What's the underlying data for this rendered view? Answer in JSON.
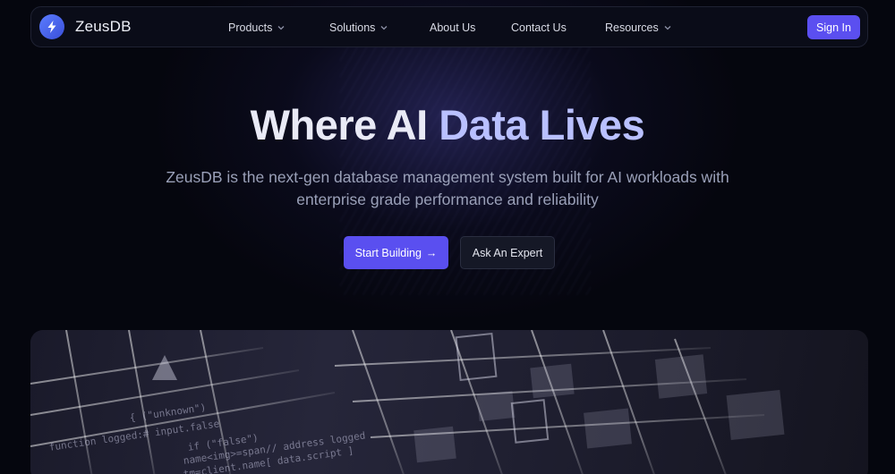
{
  "brand": {
    "name": "ZeusDB",
    "logo_icon": "lightning-bolt-icon",
    "accent": "#5b4ff0"
  },
  "nav": {
    "items": [
      {
        "label": "Products",
        "has_dropdown": true
      },
      {
        "label": "Solutions",
        "has_dropdown": true
      },
      {
        "label": "About Us",
        "has_dropdown": false
      },
      {
        "label": "Contact Us",
        "has_dropdown": false
      },
      {
        "label": "Resources",
        "has_dropdown": true
      }
    ],
    "signin_label": "Sign In"
  },
  "hero": {
    "title_part1": "Where AI ",
    "title_part2": "Data Lives",
    "subtitle": "ZeusDB is the next-gen database management system built for AI workloads with enterprise grade performance and reliability",
    "primary_cta": "Start Building",
    "primary_cta_arrow": "→",
    "secondary_cta": "Ask An Expert"
  },
  "hero_image": {
    "code_lines": [
      "{ (\"unknown\")",
      "function logged:# input.false",
      "if (\"false\")",
      "name<img>=span// address logged",
      "tm=client.name[ data.script ]"
    ]
  }
}
